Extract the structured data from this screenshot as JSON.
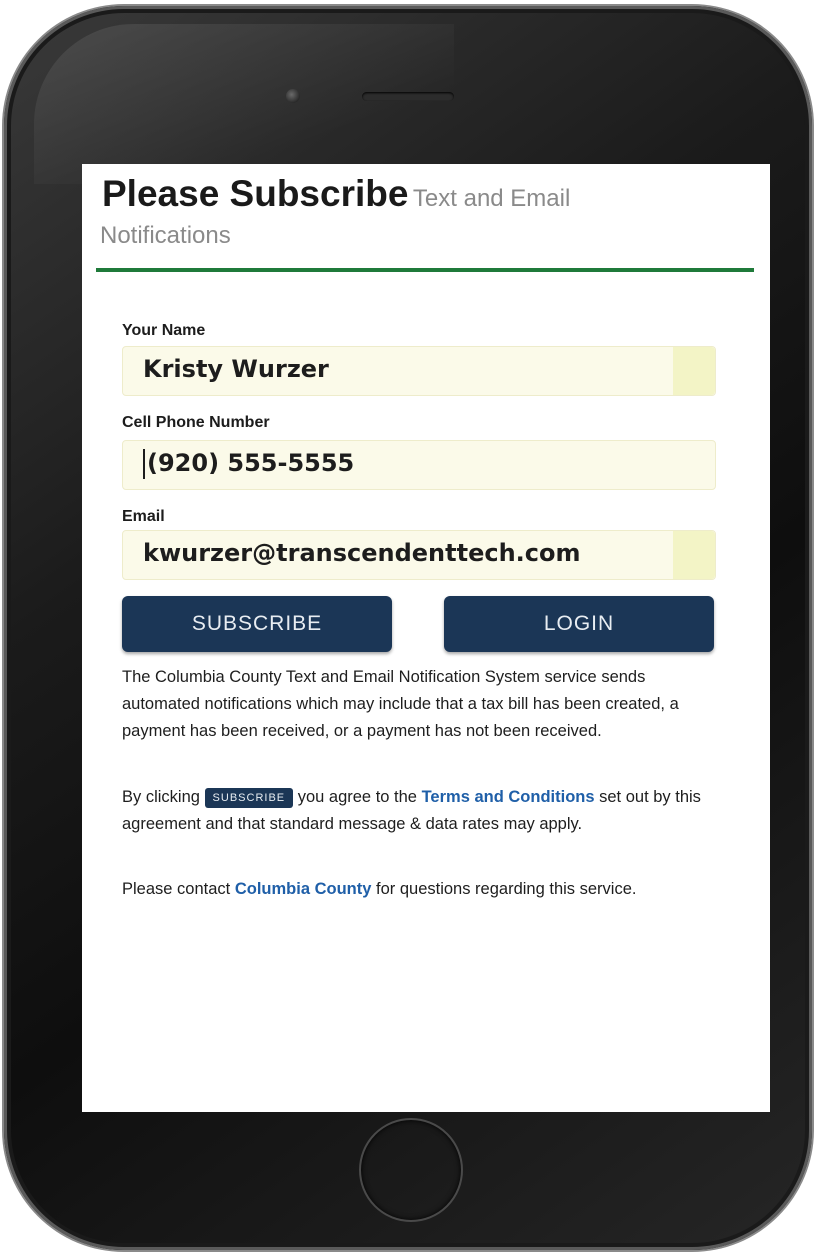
{
  "header": {
    "title_bold": "Please Subscribe",
    "title_light": "Text and Email",
    "subtitle": "Notifications"
  },
  "form": {
    "name_label": "Your Name",
    "name_value": "Kristy Wurzer",
    "phone_label": "Cell Phone Number",
    "phone_value": "(920) 555-5555",
    "email_label": "Email",
    "email_value": "kwurzer@transcendenttech.com"
  },
  "buttons": {
    "subscribe_label": "SUBSCRIBE",
    "login_label": "LOGIN"
  },
  "info": {
    "paragraph1": "The Columbia County Text and Email Notification System service sends automated notifications which may include that a tax bill has been created, a payment has been received, or a payment has not been received.",
    "p2_before": "By clicking",
    "p2_button": "SUBSCRIBE",
    "p2_middle": "you agree to the",
    "p2_link": "Terms and Conditions",
    "p2_after": "set out by this agreement and that standard message & data rates may apply.",
    "p3_before": "Please contact",
    "p3_link": "Columbia County",
    "p3_after": "for questions regarding this service."
  },
  "colors": {
    "accent_green": "#1f7a3a",
    "button_navy": "#1b3656",
    "link_blue": "#1f5fa8",
    "field_bg": "#fbfae9"
  }
}
